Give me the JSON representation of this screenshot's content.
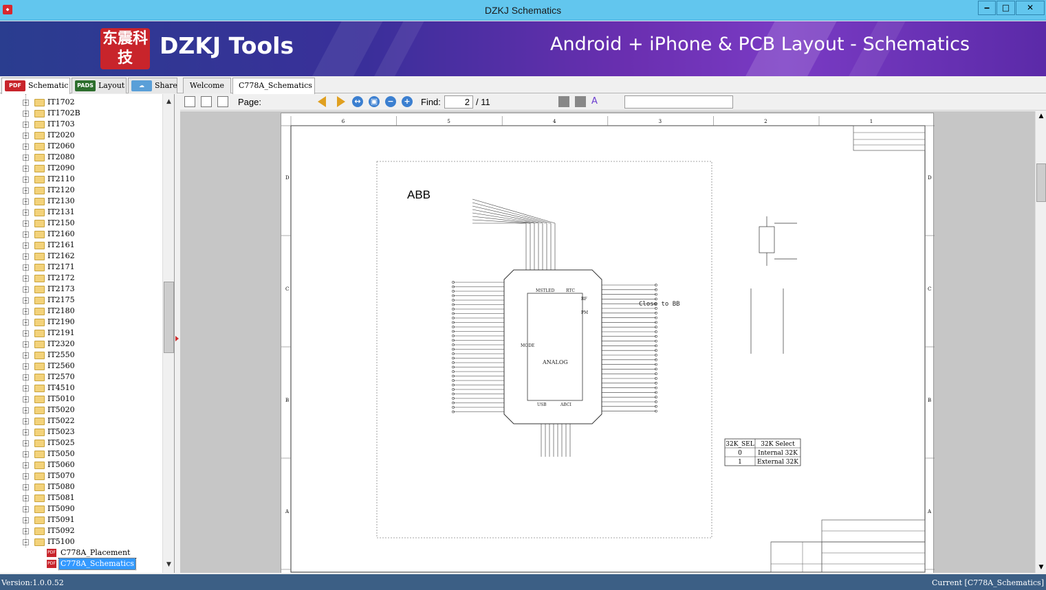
{
  "window": {
    "title": "DZKJ Schematics",
    "app_icon": "dzkj-app-icon",
    "controls": {
      "minimize": "‒",
      "maximize": "□",
      "close": "✕"
    }
  },
  "banner": {
    "logo_text": "东震科技",
    "brand": "DZKJ Tools",
    "tagline": "Android + iPhone & PCB Layout - Schematics"
  },
  "left_tabs": [
    {
      "label": "Schematic",
      "icon_text": "PDF",
      "icon_color": "#c8242b"
    },
    {
      "label": "Layout",
      "icon_text": "PADS",
      "icon_color": "#2d6e2d"
    },
    {
      "label": "Share",
      "icon_text": "☁",
      "icon_color": "#5a9fd8"
    }
  ],
  "doc_tabs": [
    {
      "label": "Welcome"
    },
    {
      "label": "C778A_Schematics"
    }
  ],
  "tree": {
    "folders": [
      "IT1702",
      "IT1702B",
      "IT1703",
      "IT2020",
      "IT2060",
      "IT2080",
      "IT2090",
      "IT2110",
      "IT2120",
      "IT2130",
      "IT2131",
      "IT2150",
      "IT2160",
      "IT2161",
      "IT2162",
      "IT2171",
      "IT2172",
      "IT2173",
      "IT2175",
      "IT2180",
      "IT2190",
      "IT2191",
      "IT2320",
      "IT2550",
      "IT2560",
      "IT2570",
      "IT4510",
      "IT5010",
      "IT5020",
      "IT5022",
      "IT5023",
      "IT5025",
      "IT5050",
      "IT5060",
      "IT5070",
      "IT5080",
      "IT5081",
      "IT5090",
      "IT5091",
      "IT5092",
      "IT5100"
    ],
    "expanded_folder": "IT5100",
    "files": [
      "C778A_Placement",
      "C778A_Schematics"
    ],
    "selected_file": "C778A_Schematics"
  },
  "toolbar": {
    "page_label": "Page:",
    "page_value": "2",
    "page_total": "/ 11",
    "find_label": "Find:",
    "find_value": ""
  },
  "status": {
    "version": "Version:1.0.0.52",
    "current": "Current [C778A_Schematics]"
  },
  "colors": {
    "titlebar": "#62c6ee",
    "banner_start": "#2a3d8f",
    "banner_end": "#7a3bc4",
    "statusbar": "#3c5f85",
    "selection": "#3399ff"
  },
  "schematic": {
    "block_title": "ABB",
    "border_numbers": [
      "6",
      "5",
      "4",
      "3",
      "2",
      "1"
    ],
    "border_letters": [
      "D",
      "C",
      "B",
      "A"
    ],
    "chip_sections": [
      "MSTLED",
      "RTC",
      "RF",
      "PM",
      "MODE",
      "USB",
      "ABCI",
      "ANALOG"
    ],
    "note": "Close to BB",
    "table": {
      "headers": [
        "32K_SEL",
        "32K Select"
      ],
      "rows": [
        [
          "0",
          "Internal 32K"
        ],
        [
          "1",
          "External 32K"
        ]
      ]
    }
  }
}
